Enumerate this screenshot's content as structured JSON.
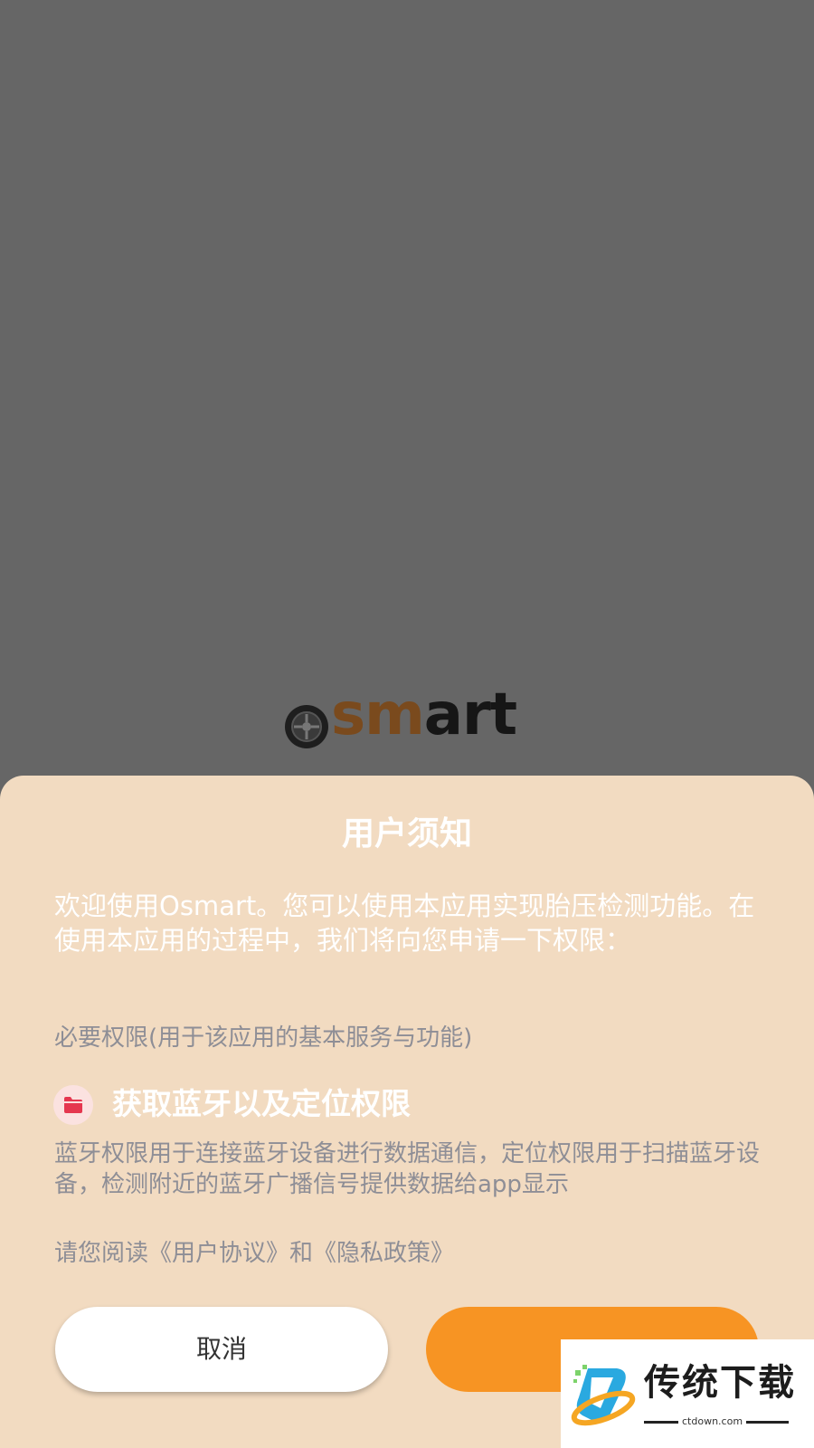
{
  "app": {
    "logo_text": "Osmart"
  },
  "dialog": {
    "title": "用户须知",
    "intro": "欢迎使用Osmart。您可以使用本应用实现胎压检测功能。在使用本应用的过程中，我们将向您申请一下权限：",
    "required_label": "必要权限(用于该应用的基本服务与功能)",
    "permission": {
      "icon": "folder-icon",
      "title": "获取蓝牙以及定位权限",
      "description": "蓝牙权限用于连接蓝牙设备进行数据通信，定位权限用于扫描蓝牙设备，检测附近的蓝牙广播信号提供数据给app显示"
    },
    "read_note": "请您阅读《用户协议》和《隐私政策》",
    "cancel_label": "取消",
    "agree_label": ""
  },
  "watermark": {
    "text": "传统下载",
    "url": "ctdown.com"
  },
  "colors": {
    "accent": "#f79423",
    "sheet": "#f2dbc1",
    "overlay": "#666666",
    "muted_text": "#8e8e96"
  }
}
